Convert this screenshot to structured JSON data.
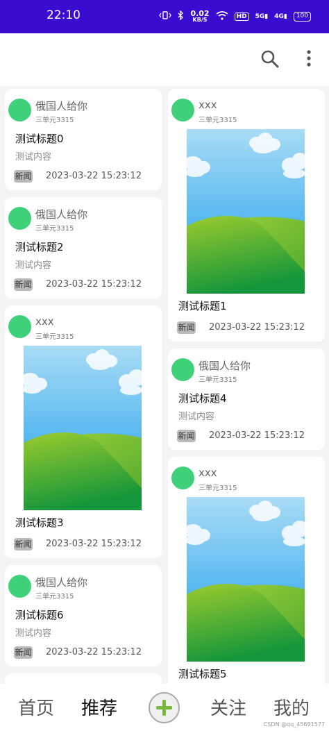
{
  "status_bar": {
    "time": "22:10",
    "net_speed_value": "0.02",
    "net_speed_unit": "KB/S",
    "hd_label": "HD",
    "signal_1": "5G",
    "signal_2": "4G",
    "battery": "100"
  },
  "icons": {
    "search": "search-icon",
    "more": "more-vert-icon",
    "add": "add-icon"
  },
  "colors": {
    "status_bar": "#3a0ccf",
    "avatar": "#3fd07a",
    "add_plus": "#76b93a"
  },
  "feed": {
    "left": [
      {
        "username": "俄国人给你",
        "address": "三单元3315",
        "title": "测试标题0",
        "content": "测试内容",
        "tag": "新闻",
        "date": "2023-03-22 15:23:12"
      },
      {
        "username": "俄国人给你",
        "address": "三单元3315",
        "title": "测试标题2",
        "content": "测试内容",
        "tag": "新闻",
        "date": "2023-03-22 15:23:12"
      },
      {
        "username": "xxx",
        "address": "三单元3315",
        "title": "测试标题3",
        "tag": "新闻",
        "date": "2023-03-22 15:23:12"
      },
      {
        "username": "俄国人给你",
        "address": "三单元3315",
        "title": "测试标题6",
        "content": "测试内容",
        "tag": "新闻",
        "date": "2023-03-22 15:23:12"
      }
    ],
    "right": [
      {
        "username": "xxx",
        "address": "三单元3315",
        "title": "测试标题1",
        "tag": "新闻",
        "date": "2023-03-22 15:23:12"
      },
      {
        "username": "俄国人给你",
        "address": "三单元3315",
        "title": "测试标题4",
        "content": "测试内容",
        "tag": "新闻",
        "date": "2023-03-22 15:23:12"
      },
      {
        "username": "xxx",
        "address": "三单元3315",
        "title": "测试标题5"
      }
    ]
  },
  "nav": {
    "home": "首页",
    "recommend": "推荐",
    "follow": "关注",
    "mine": "我的"
  },
  "watermark": "CSDN @qq_45691577"
}
